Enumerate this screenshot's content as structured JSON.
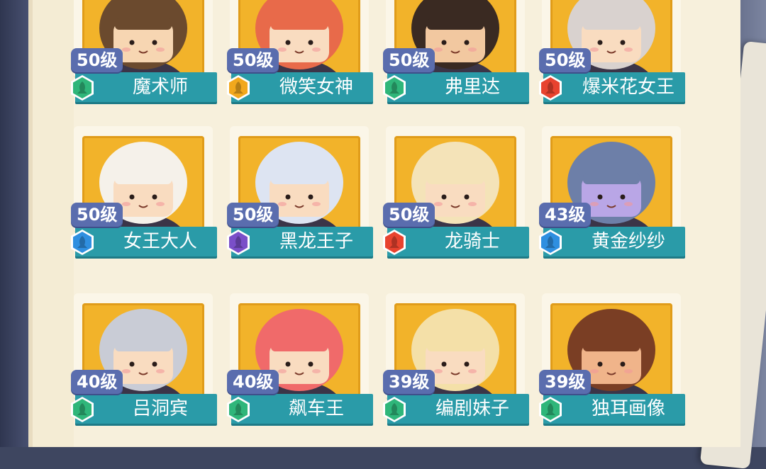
{
  "colors": {
    "portrait_bg": "#f2b32a",
    "name_bar": "#2a9ba8",
    "level_badge": "#5a6dae",
    "rank_green": "#2fb67a",
    "rank_gold": "#f2a81c",
    "rank_red": "#e8432f",
    "rank_blue": "#2f8fe0",
    "rank_purple": "#7a4fc8"
  },
  "characters": [
    {
      "level": "50级",
      "name": "魔术师",
      "rank_icon": "green-rank-icon",
      "rank_color": "#2fb67a",
      "hair": "#6b4a2e",
      "skin": "#f7d6b2"
    },
    {
      "level": "50级",
      "name": "微笑女神",
      "rank_icon": "gold-rank-icon",
      "rank_color": "#f2a81c",
      "hair": "#e86a4a",
      "skin": "#f9dcc0"
    },
    {
      "level": "50级",
      "name": "弗里达",
      "rank_icon": "green-rank-icon",
      "rank_color": "#2fb67a",
      "hair": "#3a2a22",
      "skin": "#f2c8a0"
    },
    {
      "level": "50级",
      "name": "爆米花女王",
      "rank_icon": "red-rank-icon",
      "rank_color": "#e8432f",
      "hair": "#d9d2cf",
      "skin": "#f9dcc0"
    },
    {
      "level": "50级",
      "name": "女王大人",
      "rank_icon": "blue-rank-icon",
      "rank_color": "#2f8fe0",
      "hair": "#f5f1ea",
      "skin": "#f9dcc0"
    },
    {
      "level": "50级",
      "name": "黑龙王子",
      "rank_icon": "purple-rank-icon",
      "rank_color": "#7a4fc8",
      "hair": "#dde4f2",
      "skin": "#f9dcc0"
    },
    {
      "level": "50级",
      "name": "龙骑士",
      "rank_icon": "red-rank-icon",
      "rank_color": "#e8432f",
      "hair": "#f4e3b8",
      "skin": "#f9dcc0"
    },
    {
      "level": "43级",
      "name": "黄金纱纱",
      "rank_icon": "blue-rank-icon",
      "rank_color": "#2f8fe0",
      "hair": "#6d7fa8",
      "skin": "#b9a6e6"
    },
    {
      "level": "40级",
      "name": "吕洞宾",
      "rank_icon": "green-rank-icon",
      "rank_color": "#2fb67a",
      "hair": "#c9ccd6",
      "skin": "#f9dcc0"
    },
    {
      "level": "40级",
      "name": "飙车王",
      "rank_icon": "green-rank-icon",
      "rank_color": "#2fb67a",
      "hair": "#f06a6a",
      "skin": "#f9dcc0"
    },
    {
      "level": "39级",
      "name": "编剧妹子",
      "rank_icon": "green-rank-icon",
      "rank_color": "#2fb67a",
      "hair": "#f4e0a8",
      "skin": "#f9dcc0"
    },
    {
      "level": "39级",
      "name": "独耳画像",
      "rank_icon": "green-rank-icon",
      "rank_color": "#2fb67a",
      "hair": "#7a3e24",
      "skin": "#f0b48a"
    }
  ]
}
